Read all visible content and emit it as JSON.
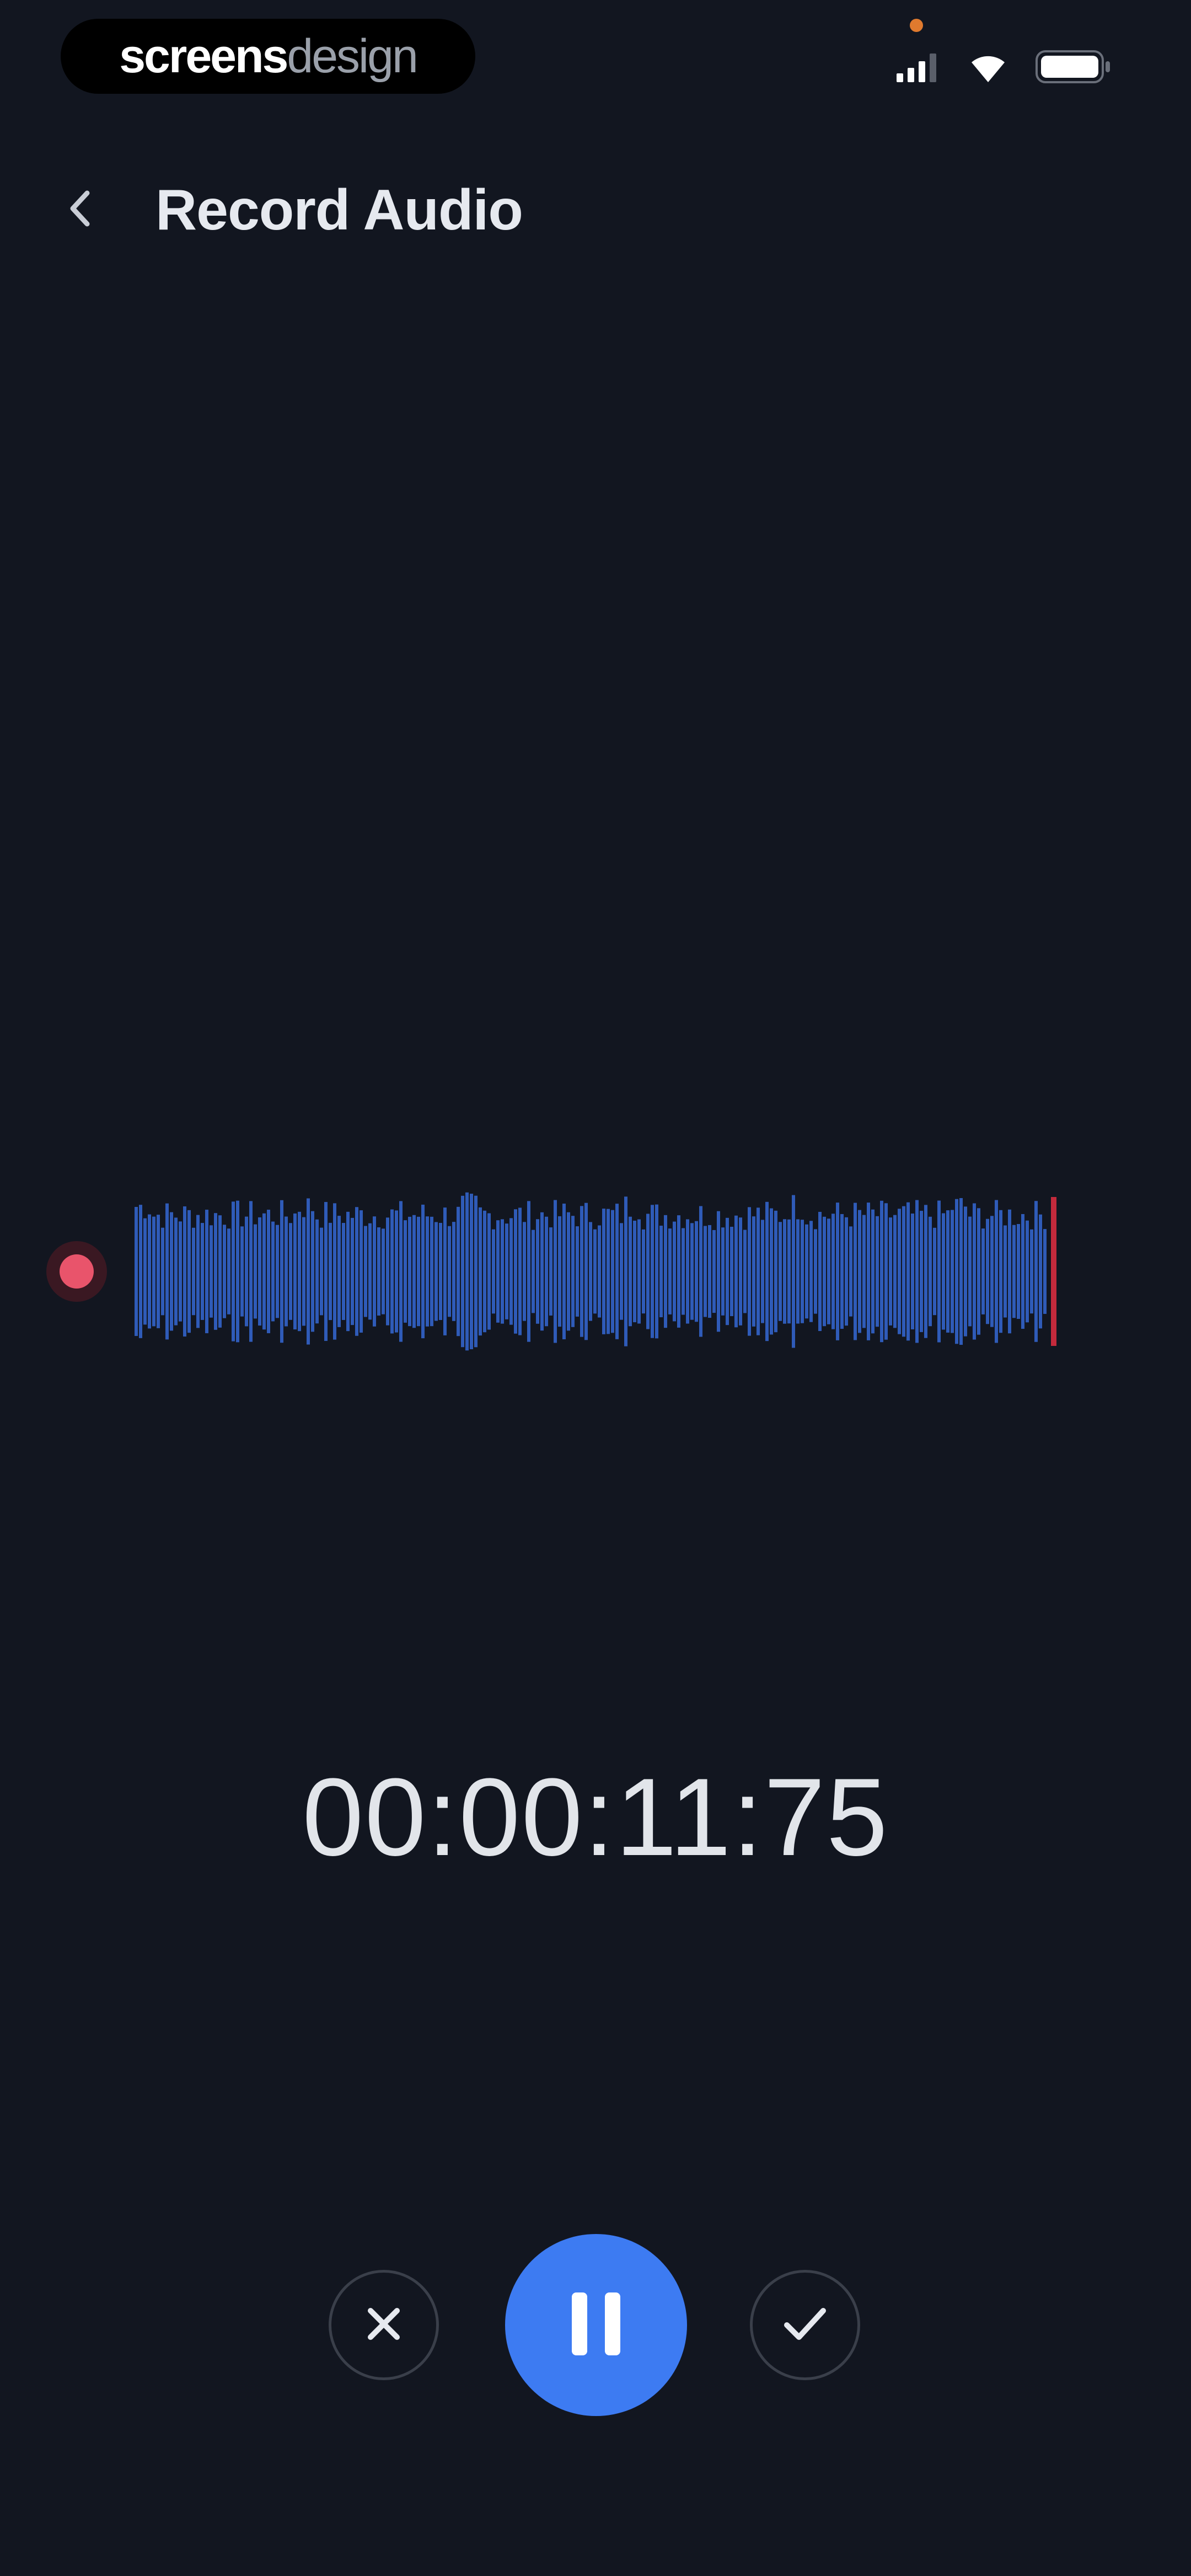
{
  "status_bar": {
    "watermark_part1": "screens",
    "watermark_part2": "design",
    "icons": [
      "cellular-signal-icon",
      "wifi-icon",
      "battery-icon"
    ]
  },
  "header": {
    "back_icon": "chevron-left-icon",
    "title": "Record Audio"
  },
  "recorder": {
    "timer": "00:00:11:75",
    "is_recording": true
  },
  "controls": {
    "cancel_icon": "close-icon",
    "pause_icon": "pause-icon",
    "confirm_icon": "checkmark-icon"
  },
  "colors": {
    "background": "#121620",
    "accent": "#3d7bf2",
    "waveform": "#2f5bb8",
    "record": "#e9546b",
    "playhead": "#c42a3c"
  }
}
